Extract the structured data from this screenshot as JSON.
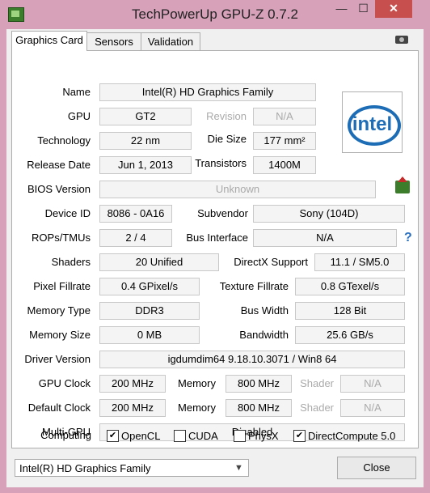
{
  "window": {
    "title": "TechPowerUp GPU-Z 0.7.2",
    "min": "—",
    "max": "☐",
    "close": "✕"
  },
  "tabs": [
    "Graphics Card",
    "Sensors",
    "Validation"
  ],
  "fields": {
    "name": {
      "label": "Name",
      "value": "Intel(R) HD Graphics Family"
    },
    "gpu": {
      "label": "GPU",
      "value": "GT2"
    },
    "revision": {
      "label": "Revision",
      "value": "N/A"
    },
    "technology": {
      "label": "Technology",
      "value": "22 nm"
    },
    "die_size": {
      "label": "Die Size",
      "value": "177 mm²"
    },
    "release_date": {
      "label": "Release Date",
      "value": "Jun 1, 2013"
    },
    "transistors": {
      "label": "Transistors",
      "value": "1400M"
    },
    "bios_version": {
      "label": "BIOS Version",
      "value": "Unknown"
    },
    "device_id": {
      "label": "Device ID",
      "value": "8086 - 0A16"
    },
    "subvendor": {
      "label": "Subvendor",
      "value": "Sony (104D)"
    },
    "rops_tmus": {
      "label": "ROPs/TMUs",
      "value": "2 / 4"
    },
    "bus_interface": {
      "label": "Bus Interface",
      "value": "N/A"
    },
    "shaders": {
      "label": "Shaders",
      "value": "20 Unified"
    },
    "directx_support": {
      "label": "DirectX Support",
      "value": "11.1 / SM5.0"
    },
    "pixel_fillrate": {
      "label": "Pixel Fillrate",
      "value": "0.4 GPixel/s"
    },
    "texture_fillrate": {
      "label": "Texture Fillrate",
      "value": "0.8 GTexel/s"
    },
    "memory_type": {
      "label": "Memory Type",
      "value": "DDR3"
    },
    "bus_width": {
      "label": "Bus Width",
      "value": "128 Bit"
    },
    "memory_size": {
      "label": "Memory Size",
      "value": "0 MB"
    },
    "bandwidth": {
      "label": "Bandwidth",
      "value": "25.6 GB/s"
    },
    "driver_version": {
      "label": "Driver Version",
      "value": "igdumdim64 9.18.10.3071 / Win8 64"
    },
    "gpu_clock": {
      "label": "GPU Clock",
      "value": "200 MHz",
      "memory_label": "Memory",
      "memory_value": "800 MHz",
      "shader_label": "Shader",
      "shader_value": "N/A"
    },
    "default_clock": {
      "label": "Default Clock",
      "value": "200 MHz",
      "memory_label": "Memory",
      "memory_value": "800 MHz",
      "shader_label": "Shader",
      "shader_value": "N/A"
    },
    "multi_gpu": {
      "label": "Multi-GPU",
      "value": "Disabled"
    }
  },
  "computing": {
    "label": "Computing",
    "options": [
      {
        "name": "OpenCL",
        "checked": true
      },
      {
        "name": "CUDA",
        "checked": false
      },
      {
        "name": "PhysX",
        "checked": false
      },
      {
        "name": "DirectCompute 5.0",
        "checked": true
      }
    ]
  },
  "logo": {
    "text": "intel",
    "color": "#1c6db5"
  },
  "footer": {
    "selected_gpu": "Intel(R) HD Graphics Family",
    "close_label": "Close"
  },
  "icons": {
    "help": "?",
    "check": "✔",
    "dropdown": "▼"
  }
}
